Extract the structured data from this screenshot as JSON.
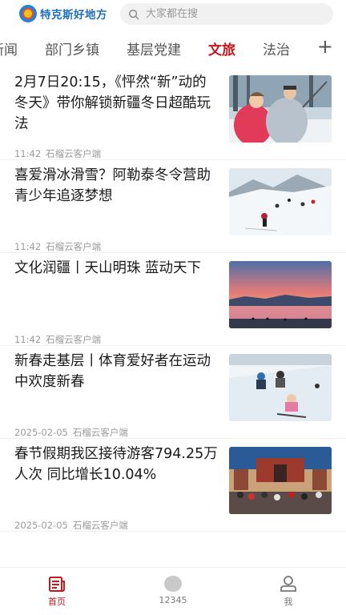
{
  "header": {
    "logo_text": "特克斯好地方",
    "search_placeholder": "大家都在搜"
  },
  "tabs": [
    {
      "label": "新闻",
      "active": false
    },
    {
      "label": "部门乡镇",
      "active": false
    },
    {
      "label": "基层党建",
      "active": false
    },
    {
      "label": "文旅",
      "active": true
    },
    {
      "label": "法治",
      "active": false
    }
  ],
  "tab_add_label": "+",
  "news": [
    {
      "title": "2月7日20:15，《怦然“新”动的冬天》带你解锁新疆冬日超酷玩法",
      "time": "11:42",
      "source": "石榴云客户端",
      "image": "ski-portrait"
    },
    {
      "title": "喜爱滑冰滑雪？阿勒泰冬令营助青少年追逐梦想",
      "time": "11:42",
      "source": "石榴云客户端",
      "image": "ski-slope"
    },
    {
      "title": "文化润疆丨天山明珠 蓝动天下",
      "time": "11:42",
      "source": "石榴云客户端",
      "image": "lake-sunset"
    },
    {
      "title": "新春走基层丨体育爱好者在运动中欢度新春",
      "time": "2025-02-05",
      "source": "石榴云客户端",
      "image": "ice-sled"
    },
    {
      "title": "春节假期我区接待游客794.25万人次 同比增长10.04%",
      "time": "2025-02-05",
      "source": "石榴云客户端",
      "image": "festival-crowd"
    }
  ],
  "bottom_nav": [
    {
      "label": "首页",
      "icon": "home-news-icon",
      "active": true
    },
    {
      "label": "12345",
      "icon": "hotline-icon",
      "active": false
    },
    {
      "label": "我",
      "icon": "user-icon",
      "active": false
    }
  ],
  "colors": {
    "accent": "#c8161d",
    "brand": "#1f6fbf"
  }
}
